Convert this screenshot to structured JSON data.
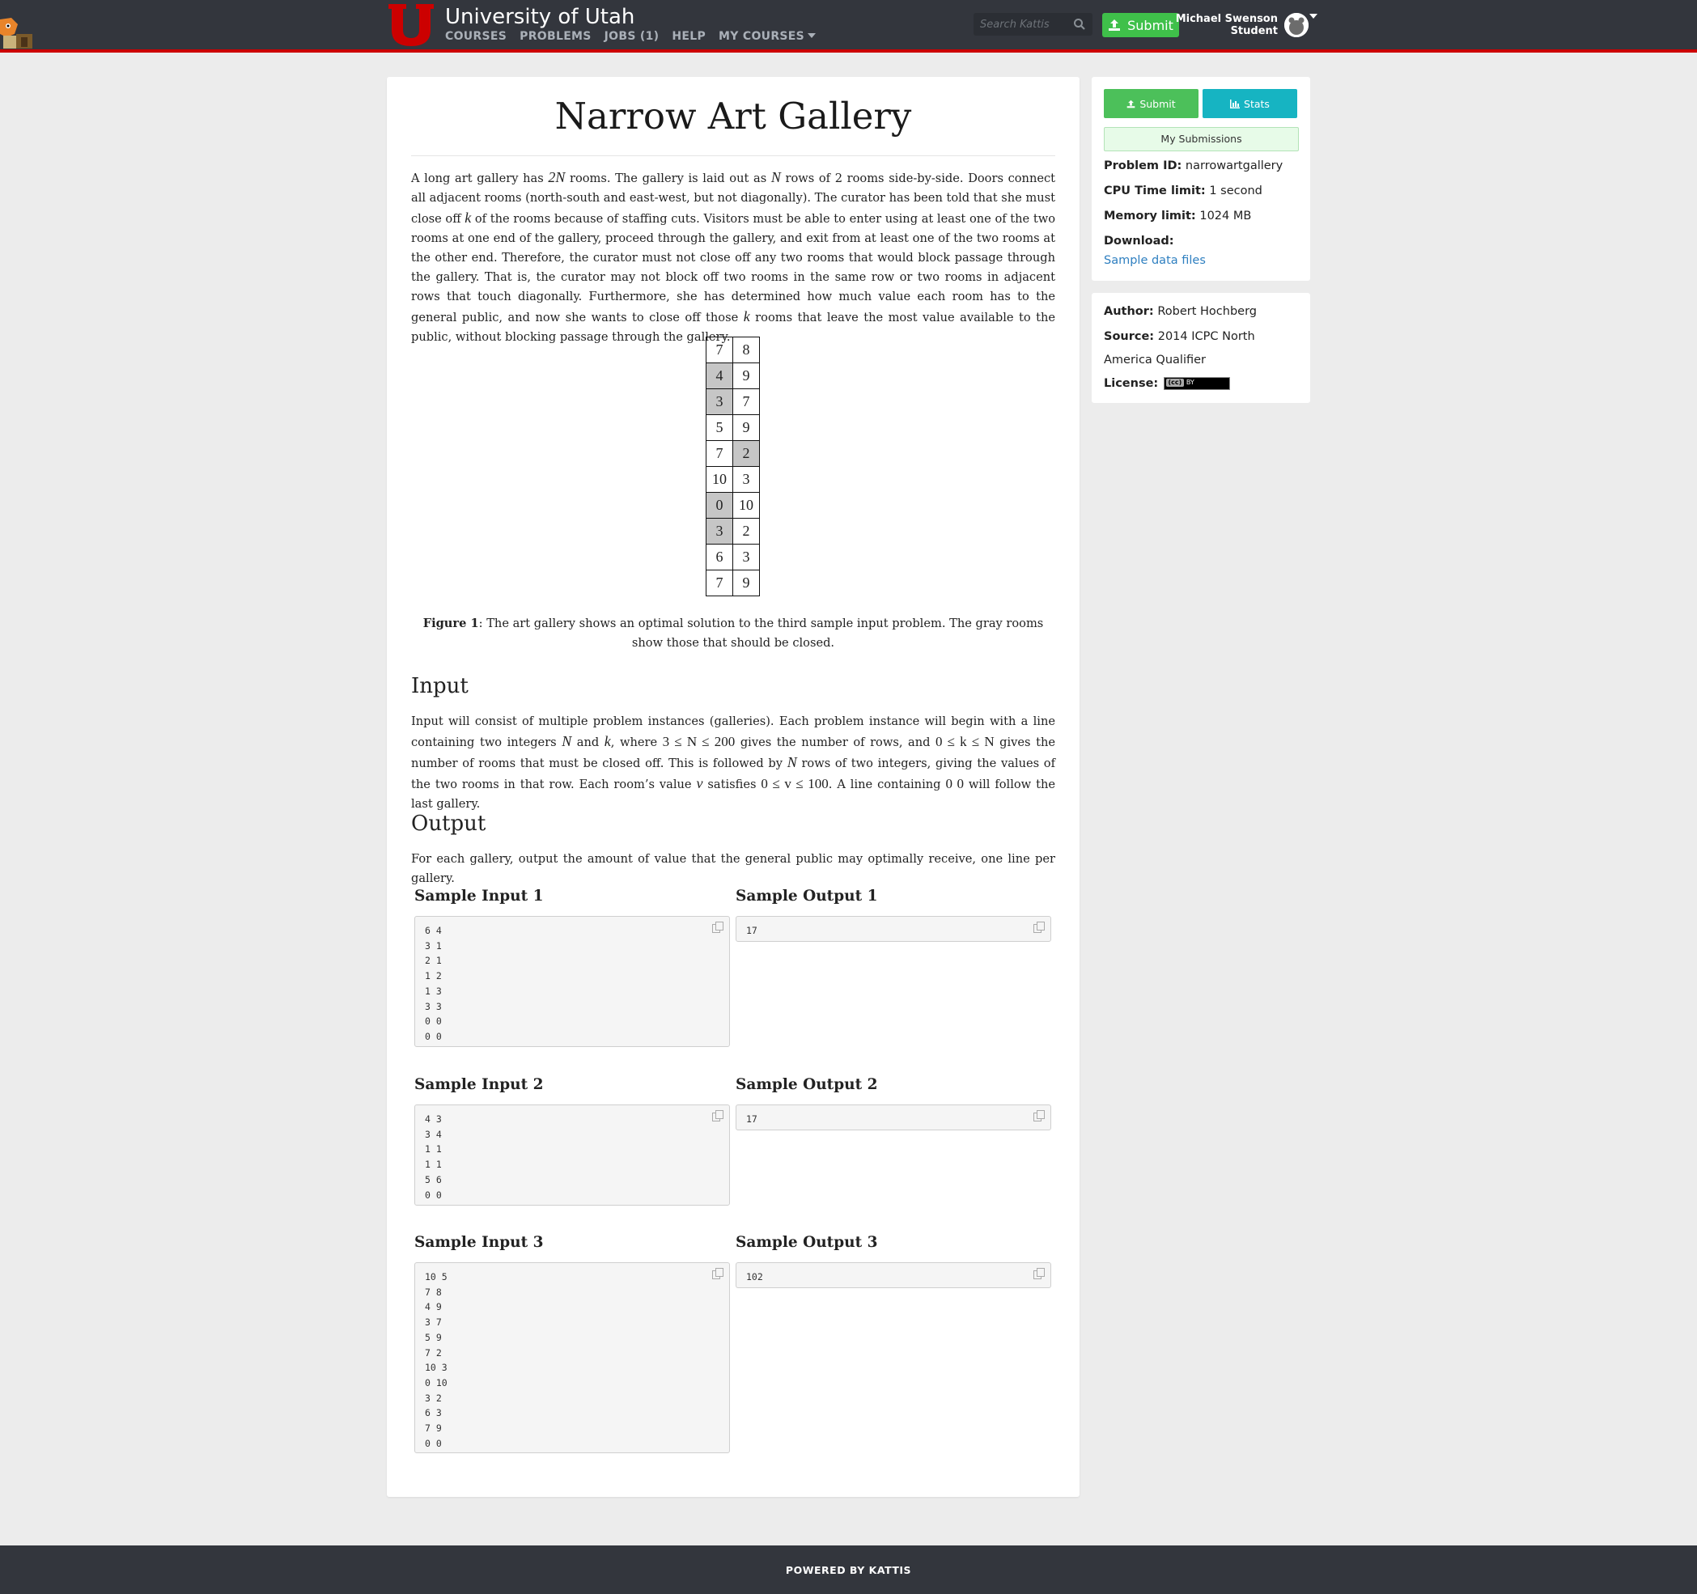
{
  "header": {
    "site_title": "University of Utah",
    "nav": [
      {
        "label": "COURSES"
      },
      {
        "label": "PROBLEMS"
      },
      {
        "label": "JOBS (1)"
      },
      {
        "label": "HELP"
      },
      {
        "label": "MY COURSES"
      }
    ],
    "search_placeholder": "Search Kattis",
    "submit_label": "Submit",
    "user_name": "Michael Swenson",
    "user_role": "Student",
    "accent_color": "#cc0000",
    "icons": {
      "search": "search-icon",
      "submit": "upload-icon",
      "logo": "university-u-logo",
      "mascot": "mascot-logo",
      "avatar": "user-avatar"
    }
  },
  "problem": {
    "title": "Narrow Art Gallery",
    "statement": [
      {
        "t": "A long art gallery has "
      },
      {
        "m": "2N",
        "v": true
      },
      {
        "t": " rooms. The gallery is laid out as "
      },
      {
        "m": "N",
        "v": true
      },
      {
        "t": " rows of 2 rooms side-by-side. Doors connect all adjacent rooms (north-south and east-west, but not diagonally). The curator has been told that she must close off "
      },
      {
        "m": "k",
        "v": true
      },
      {
        "t": " of the rooms because of staffing cuts. Visitors must be able to enter using at least one of the two rooms at one end of the gallery, proceed through the gallery, and exit from at least one of the two rooms at the other end. Therefore, the curator must not close off any two rooms that would block passage through the gallery. That is, the curator may not block off two rooms in the same row or two rooms in adjacent rows that touch diagonally. Furthermore, she has determined how much value each room has to the general public, and now she wants to close off those "
      },
      {
        "m": "k",
        "v": true
      },
      {
        "t": " rooms that leave the most value available to the public, without blocking passage through the gallery."
      }
    ],
    "gallery_rows": [
      {
        "left": "7",
        "right": "8",
        "left_closed": false,
        "right_closed": false
      },
      {
        "left": "4",
        "right": "9",
        "left_closed": true,
        "right_closed": false
      },
      {
        "left": "3",
        "right": "7",
        "left_closed": true,
        "right_closed": false
      },
      {
        "left": "5",
        "right": "9",
        "left_closed": false,
        "right_closed": false
      },
      {
        "left": "7",
        "right": "2",
        "left_closed": false,
        "right_closed": true
      },
      {
        "left": "10",
        "right": "3",
        "left_closed": false,
        "right_closed": false
      },
      {
        "left": "0",
        "right": "10",
        "left_closed": true,
        "right_closed": false
      },
      {
        "left": "3",
        "right": "2",
        "left_closed": true,
        "right_closed": false
      },
      {
        "left": "6",
        "right": "3",
        "left_closed": false,
        "right_closed": false
      },
      {
        "left": "7",
        "right": "9",
        "left_closed": false,
        "right_closed": false
      }
    ],
    "closed_color": "#c6c6c6",
    "figure_label": "Figure 1",
    "figure_caption": ": The art gallery shows an optimal solution to the third sample input problem. The gray rooms show those that should be closed.",
    "input_heading": "Input",
    "input_text": [
      {
        "t": "Input will consist of multiple problem instances (galleries). Each problem instance will begin with a line containing two integers "
      },
      {
        "m": "N",
        "v": true
      },
      {
        "t": " and "
      },
      {
        "m": "k",
        "v": true
      },
      {
        "t": ", where "
      },
      {
        "m": "3 ≤ N ≤ 200",
        "v": false
      },
      {
        "t": " gives the number of rows, and "
      },
      {
        "m": "0 ≤ k ≤ N",
        "v": false
      },
      {
        "t": " gives the number of rooms that must be closed off. This is followed by "
      },
      {
        "m": "N",
        "v": true
      },
      {
        "t": " rows of two integers, giving the values of the two rooms in that row. Each room’s value "
      },
      {
        "m": "v",
        "v": true
      },
      {
        "t": " satisfies "
      },
      {
        "m": "0 ≤ v ≤ 100",
        "v": false
      },
      {
        "t": ". A line containing "
      },
      {
        "m": "0 0",
        "v": false
      },
      {
        "t": " will follow the last gallery."
      }
    ],
    "output_heading": "Output",
    "output_text": "For each gallery, output the amount of value that the general public may optimally receive, one line per gallery.",
    "samples": [
      {
        "input_label": "Sample Input 1",
        "output_label": "Sample Output 1",
        "input": "6 4\n3 1\n2 1\n1 2\n1 3\n3 3\n0 0\n0 0",
        "output": "17"
      },
      {
        "input_label": "Sample Input 2",
        "output_label": "Sample Output 2",
        "input": "4 3\n3 4\n1 1\n1 1\n5 6\n0 0",
        "output": "17"
      },
      {
        "input_label": "Sample Input 3",
        "output_label": "Sample Output 3",
        "input": "10 5\n7 8\n4 9\n3 7\n5 9\n7 2\n10 3\n0 10\n3 2\n6 3\n7 9\n0 0",
        "output": "102"
      }
    ]
  },
  "sidebar": {
    "submit_label": "Submit",
    "stats_label": "Stats",
    "my_submissions_label": "My Submissions",
    "problem_id_label": "Problem ID:",
    "problem_id": "narrowartgallery",
    "cpu_label": "CPU Time limit:",
    "cpu_value": "1 second",
    "memory_label": "Memory limit:",
    "memory_value": "1024 MB",
    "download_label": "Download:",
    "download_link": "Sample data files",
    "author_label": "Author:",
    "author": "Robert Hochberg",
    "source_label": "Source:",
    "source": "2014 ICPC North America Qualifier",
    "license_label": "License:",
    "license_badge_cc": "(cc)",
    "license_badge_by": "BY",
    "button_colors": {
      "submit": "#4cc05a",
      "stats": "#16b4c2"
    }
  },
  "footer": {
    "text": "POWERED BY KATTIS"
  }
}
